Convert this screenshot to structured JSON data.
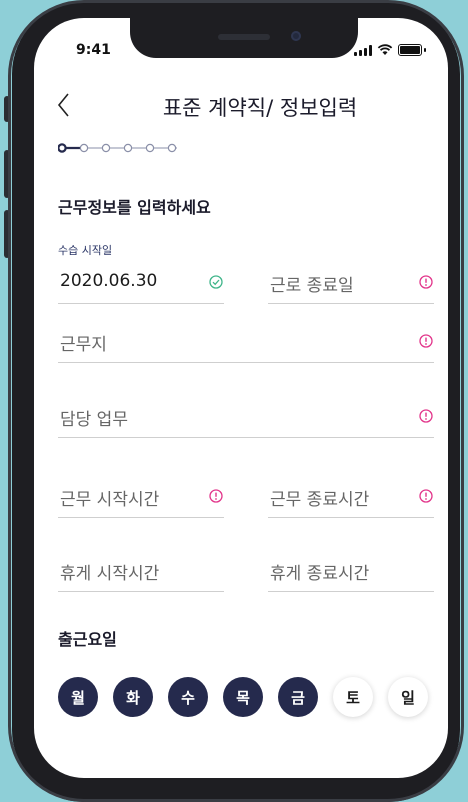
{
  "status": {
    "time": "9:41"
  },
  "header": {
    "title": "표준 계약직/ 정보입력"
  },
  "form": {
    "section_title": "근무정보를 입력하세요",
    "start_date": {
      "label": "수습 시작일",
      "value": "2020.06.30"
    },
    "end_date": {
      "placeholder": "근로 종료일"
    },
    "workplace": {
      "placeholder": "근무지"
    },
    "duty": {
      "placeholder": "담당 업무"
    },
    "work_start": {
      "placeholder": "근무 시작시간"
    },
    "work_end": {
      "placeholder": "근무 종료시간"
    },
    "break_start": {
      "placeholder": "휴게 시작시간"
    },
    "break_end": {
      "placeholder": "휴게 종료시간"
    }
  },
  "workdays": {
    "title": "출근요일",
    "days": [
      {
        "label": "월",
        "selected": true
      },
      {
        "label": "화",
        "selected": true
      },
      {
        "label": "수",
        "selected": true
      },
      {
        "label": "목",
        "selected": true
      },
      {
        "label": "금",
        "selected": true
      },
      {
        "label": "토",
        "selected": false
      },
      {
        "label": "일",
        "selected": false
      }
    ]
  },
  "progress": {
    "current_step": 1,
    "total_steps": 6
  },
  "colors": {
    "accent_navy": "#252a4d",
    "warning_pink": "#e2348a",
    "success_green": "#3fb58a",
    "background_teal": "#8ecfd7"
  },
  "icons": [
    "back-chevron-icon",
    "check-circle-icon",
    "alert-circle-icon",
    "signal-icon",
    "wifi-icon",
    "battery-icon"
  ]
}
